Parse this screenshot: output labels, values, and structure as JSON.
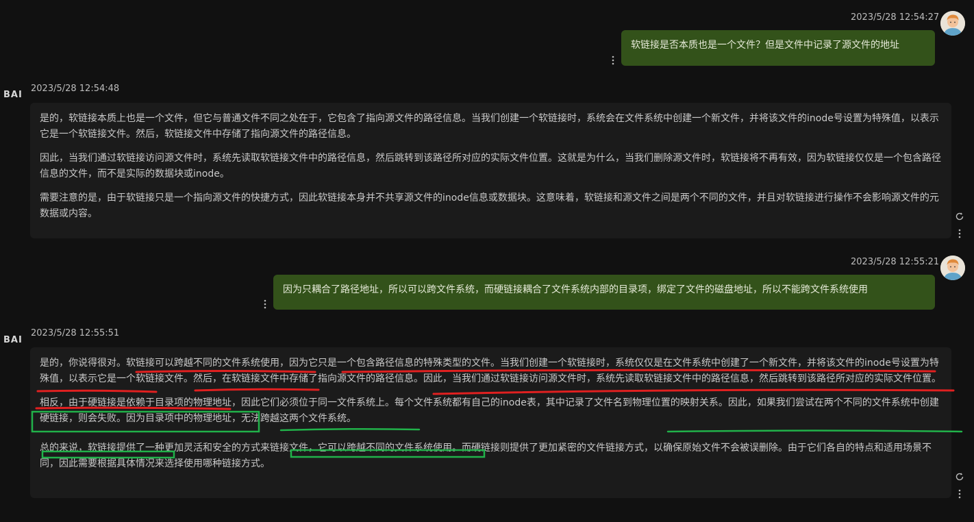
{
  "conversation": [
    {
      "role": "user",
      "timestamp": "2023/5/28 12:54:27",
      "text": "软链接是否本质也是一个文件？但是文件中记录了源文件的地址"
    },
    {
      "role": "assistant",
      "sender": "BAI",
      "timestamp": "2023/5/28 12:54:48",
      "paragraphs": [
        "是的，软链接本质上也是一个文件，但它与普通文件不同之处在于，它包含了指向源文件的路径信息。当我们创建一个软链接时，系统会在文件系统中创建一个新文件，并将该文件的inode号设置为特殊值，以表示它是一个软链接文件。然后，软链接文件中存储了指向源文件的路径信息。",
        "因此，当我们通过软链接访问源文件时，系统先读取软链接文件中的路径信息，然后跳转到该路径所对应的实际文件位置。这就是为什么，当我们删除源文件时，软链接将不再有效，因为软链接仅仅是一个包含路径信息的文件，而不是实际的数据块或inode。",
        "需要注意的是，由于软链接只是一个指向源文件的快捷方式，因此软链接本身并不共享源文件的inode信息或数据块。这意味着，软链接和源文件之间是两个不同的文件，并且对软链接进行操作不会影响源文件的元数据或内容。"
      ]
    },
    {
      "role": "user",
      "timestamp": "2023/5/28 12:55:21",
      "text": "因为只耦合了路径地址，所以可以跨文件系统，而硬链接耦合了文件系统内部的目录项，绑定了文件的磁盘地址，所以不能跨文件系统使用"
    },
    {
      "role": "assistant",
      "sender": "BAI",
      "timestamp": "2023/5/28 12:55:51",
      "paragraphs": [
        "是的，你说得很对。软链接可以跨越不同的文件系统使用，因为它只是一个包含路径信息的特殊类型的文件。当我们创建一个软链接时，系统仅仅是在文件系统中创建了一个新文件，并将该文件的inode号设置为特殊值，以表示它是一个软链接文件。然后，在软链接文件中存储了指向源文件的路径信息。因此，当我们通过软链接访问源文件时，系统先读取软链接文件中的路径信息，然后跳转到该路径所对应的实际文件位置。",
        "相反，由于硬链接是依赖于目录项的物理地址，因此它们必须位于同一文件系统上。每个文件系统都有自己的inode表，其中记录了文件名到物理位置的映射关系。因此，如果我们尝试在两个不同的文件系统中创建硬链接，则会失败。因为目录项中的物理地址，无法跨越这两个文件系统。",
        "总的来说，软链接提供了一种更加灵活和安全的方式来链接文件，它可以跨越不同的文件系统使用。而硬链接则提供了更加紧密的文件链接方式，以确保原始文件不会被误删除。由于它们各自的特点和适用场景不同，因此需要根据具体情况来选择使用哪种链接方式。"
      ]
    }
  ],
  "icons": {
    "user_avatar": "user-avatar-icon",
    "message_menu": "kebab-menu-icon",
    "regenerate": "refresh-icon"
  },
  "annotations": {
    "red_underline_color": "#e02020",
    "green_mark_color": "#21b24a"
  },
  "colors": {
    "background": "#111111",
    "user_bubble": "#33521a",
    "assistant_bubble": "#1b1b1b"
  }
}
